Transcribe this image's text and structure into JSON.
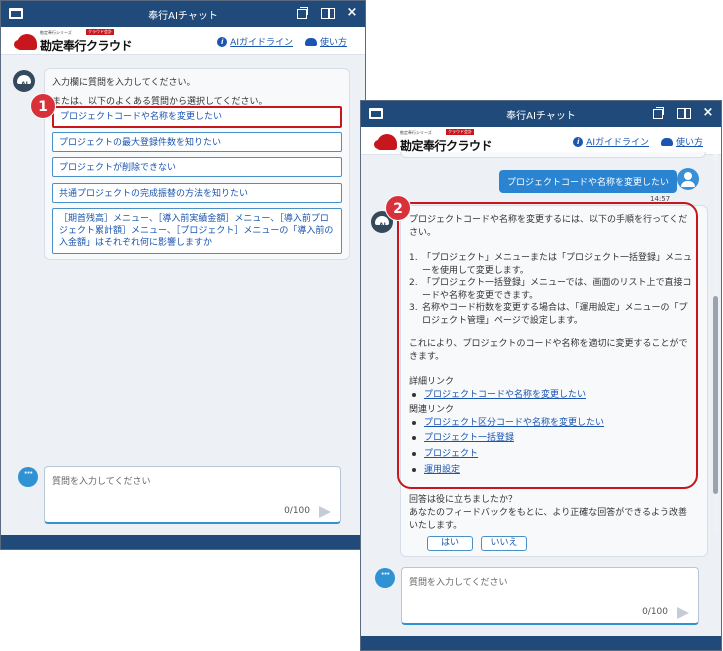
{
  "window1": {
    "title": "奉行AIチャット",
    "logo": {
      "sub": "勘定奉行シリーズ",
      "badge": "クラウド会計",
      "name": "勘定奉行クラウド"
    },
    "header": {
      "ai_guideline": "AIガイドライン",
      "how_to": "使い方"
    },
    "bot_message": {
      "line1": "入力欄に質問を入力してください。",
      "line2": "または、以下のよくある質問から選択してください。"
    },
    "suggestions": [
      "プロジェクトコードや名称を変更したい",
      "プロジェクトの最大登録件数を知りたい",
      "プロジェクトが削除できない",
      "共通プロジェクトの完成振替の方法を知りたい",
      "［期首残高］メニュー、［導入前実績金額］メニュー、［導入前プロジェクト累計額］メニュー、［プロジェクト］メニューの「導入前の入金額」はそれぞれ何に影響しますか"
    ],
    "input": {
      "placeholder": "質問を入力してください",
      "counter": "0/100"
    },
    "marker": "1"
  },
  "window2": {
    "title": "奉行AIチャット",
    "logo": {
      "sub": "勘定奉行シリーズ",
      "badge": "クラウド会計",
      "name": "勘定奉行クラウド"
    },
    "header": {
      "ai_guideline": "AIガイドライン",
      "how_to": "使い方"
    },
    "user_message": "プロジェクトコードや名称を変更したい",
    "timestamp": "14:57",
    "answer": {
      "intro": "プロジェクトコードや名称を変更するには、以下の手順を行ってください。",
      "steps": [
        "「プロジェクト」メニューまたは「プロジェクト一括登録」メニューを使用して変更します。",
        "「プロジェクト一括登録」メニューでは、画面のリスト上で直接コードや名称を変更できます。",
        "名称やコード桁数を変更する場合は、「運用設定」メニューの「プロジェクト管理」ページで設定します。"
      ],
      "step_numbers": [
        "1.",
        "2.",
        "3."
      ],
      "conclusion": "これにより、プロジェクトのコードや名称を適切に変更することができます。",
      "detail_heading": "詳細リンク",
      "detail_links": [
        "プロジェクトコードや名称を変更したい"
      ],
      "related_heading": "関連リンク",
      "related_links": [
        "プロジェクト区分コードや名称を変更したい",
        "プロジェクト一括登録",
        "プロジェクト",
        "運用設定"
      ]
    },
    "feedback": {
      "question": "回答は役に立ちましたか？",
      "note": "あなたのフィードバックをもとに、より正確な回答ができるよう改善いたします。",
      "yes": "はい",
      "no": "いいえ"
    },
    "input": {
      "placeholder": "質問を入力してください",
      "counter": "0/100"
    },
    "marker": "2"
  }
}
